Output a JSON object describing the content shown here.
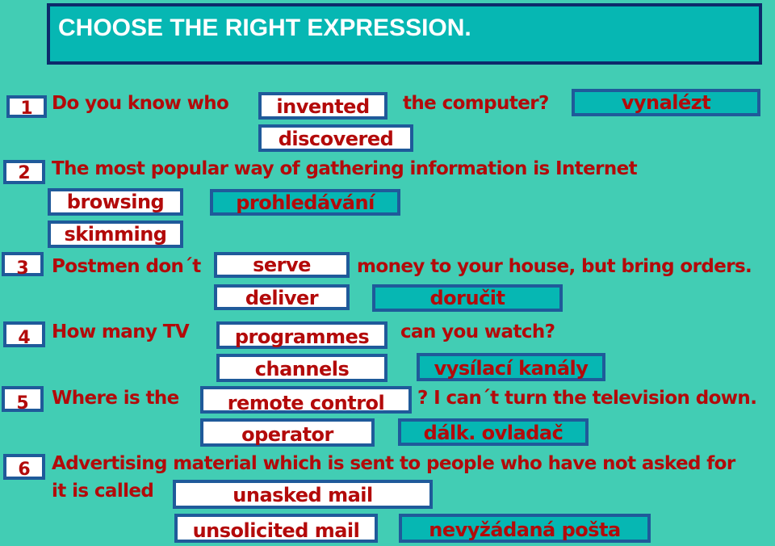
{
  "title": "CHOOSE THE RIGHT EXPRESSION.",
  "colors": {
    "background": "#42cdb4",
    "title_fill": "#06b7b3",
    "title_border": "#0d2a6b",
    "text": "#b30a0a",
    "box_border": "#1f5a9a",
    "option_fill": "#ffffff",
    "translation_fill": "#06b7b3"
  },
  "questions": [
    {
      "number": "1",
      "text_before": "Do you know who",
      "text_after": "the computer?",
      "options": [
        "invented",
        "discovered"
      ],
      "translation": "vynalézt"
    },
    {
      "number": "2",
      "text_before": "The most popular way of  gathering information is  Internet",
      "options": [
        "browsing",
        "skimming"
      ],
      "translation": "prohledávání"
    },
    {
      "number": "3",
      "text_before": "Postmen don´t",
      "text_after": "money to your house, but bring orders.",
      "options": [
        "serve",
        "deliver"
      ],
      "translation": "doručit"
    },
    {
      "number": "4",
      "text_before": "How many TV",
      "text_after": "can you watch?",
      "options": [
        "programmes",
        "channels"
      ],
      "translation": "vysílací kanály"
    },
    {
      "number": "5",
      "text_before": "Where is the",
      "text_after": "? I can´t turn the television down.",
      "options": [
        "remote control",
        "operator"
      ],
      "translation": "dálk. ovladač"
    },
    {
      "number": "6",
      "text_before": "Advertising material which is sent to people who have not asked for",
      "text_line2": "it  is called",
      "options": [
        "unasked mail",
        "unsolicited mail"
      ],
      "translation": "nevyžádaná pošta"
    }
  ]
}
